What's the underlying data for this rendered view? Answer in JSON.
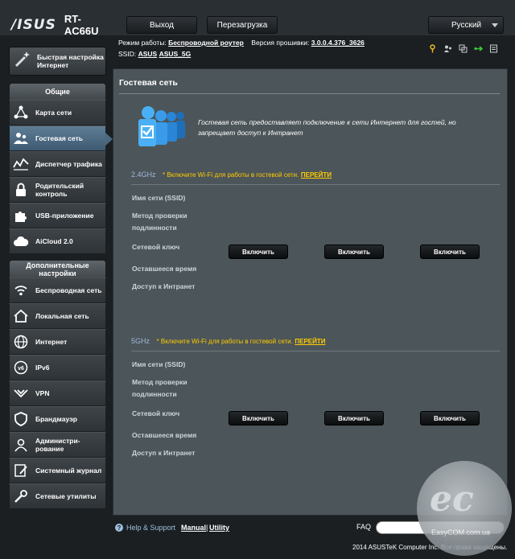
{
  "header": {
    "brand": "/ISUS",
    "model": "RT-AC66U",
    "logout_label": "Выход",
    "reboot_label": "Перезагрузка",
    "language": "Русский",
    "mode_label": "Режим работы:",
    "mode_value": "Беспроводной роутер",
    "firmware_label": "Версия прошивки:",
    "firmware_value": "3.0.0.4.376_3626",
    "ssid_label": "SSID:",
    "ssid_1": "ASUS",
    "ssid_2": "ASUS_5G"
  },
  "sidebar": {
    "quick_setup": "Быстрая настройка Интернет",
    "general_header": "Общие",
    "general_items": [
      {
        "label": "Карта сети",
        "icon": "network-map-icon"
      },
      {
        "label": "Гостевая сеть",
        "icon": "guest-network-icon",
        "active": true
      },
      {
        "label": "Диспетчер трафика",
        "icon": "traffic-manager-icon"
      },
      {
        "label": "Родительский контроль",
        "icon": "parental-control-icon"
      },
      {
        "label": "USB-приложение",
        "icon": "usb-app-icon"
      },
      {
        "label": "AiCloud 2.0",
        "icon": "aicloud-icon"
      }
    ],
    "advanced_header": "Дополнительные настройки",
    "advanced_items": [
      {
        "label": "Беспроводная сеть",
        "icon": "wireless-icon"
      },
      {
        "label": "Локальная сеть",
        "icon": "lan-icon"
      },
      {
        "label": "Интернет",
        "icon": "internet-icon"
      },
      {
        "label": "IPv6",
        "icon": "ipv6-icon"
      },
      {
        "label": "VPN",
        "icon": "vpn-icon"
      },
      {
        "label": "Брандмауэр",
        "icon": "firewall-icon"
      },
      {
        "label": "Администри-рование",
        "icon": "administration-icon"
      },
      {
        "label": "Системный журнал",
        "icon": "system-log-icon"
      },
      {
        "label": "Сетевые утилиты",
        "icon": "network-tools-icon"
      }
    ]
  },
  "main": {
    "title": "Гостевая сеть",
    "description": "Гостевая сеть предоставляет подключение к сети Интернет для гостей, но запрещает доступ к Интранет",
    "bands": [
      {
        "name": "2.4GHz",
        "note": "* Включите Wi-Fi для работы в гостевой сети.",
        "link": "ПЕРЕЙТИ",
        "rows": [
          "Имя сети (SSID)",
          "Метод проверки подлинности",
          "Сетевой ключ",
          "Оставшееся время",
          "Доступ к Интранет"
        ],
        "buttons": [
          "Включить",
          "Включить",
          "Включить"
        ]
      },
      {
        "name": "5GHz",
        "note": "* Включите Wi-Fi для работы в гостевой сети.",
        "link": "ПЕРЕЙТИ",
        "rows": [
          "Имя сети (SSID)",
          "Метод проверки подлинности",
          "Сетевой ключ",
          "Оставшееся время",
          "Доступ к Интранет"
        ],
        "buttons": [
          "Включить",
          "Включить",
          "Включить"
        ]
      }
    ]
  },
  "footer": {
    "help": "Help & Support",
    "manual": "Manual",
    "sep": "|",
    "utility": "Utility",
    "faq": "FAQ",
    "copyright": "2014 ASUSTeK Computer Inc. Все права защищены."
  },
  "watermark": {
    "text": "EasyCOM.com.ua"
  },
  "colors": {
    "panel": "#4c5559",
    "accent_band": "#9fb8d9",
    "warning": "#ffcc00",
    "active_nav": "#4b6880"
  }
}
